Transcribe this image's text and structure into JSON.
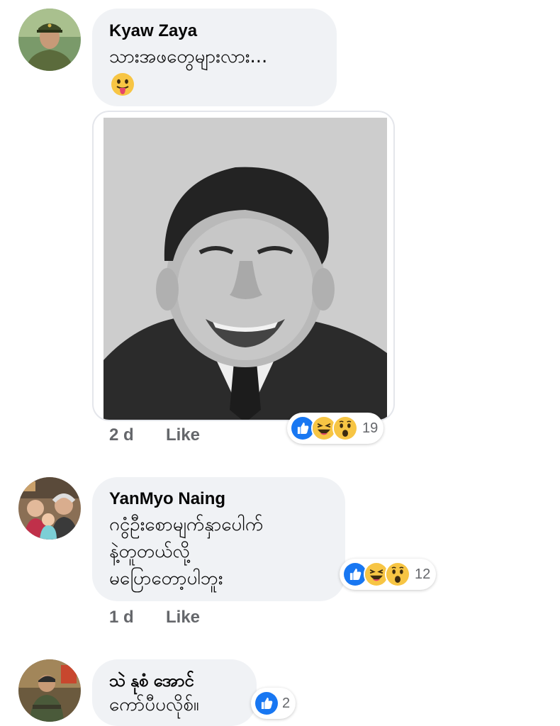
{
  "comments": [
    {
      "author": "Kyaw Zaya",
      "text_lines": [
        "သားအဖတွေများလား..."
      ],
      "emoji": "tongue-out-emoji",
      "timestamp": "2 d",
      "like_label": "Like",
      "reactions": [
        "like-reaction-icon",
        "haha-reaction-icon",
        "wow-reaction-icon"
      ],
      "reaction_count": "19"
    },
    {
      "author": "YanMyo Naing",
      "text_lines": [
        "ဂငွံဦးစောမျက်နှာပေါက်",
        "နဲ့တူတယ်လို့",
        "မပြောတော့ပါဘူး"
      ],
      "timestamp": "1 d",
      "like_label": "Like",
      "reactions": [
        "like-reaction-icon",
        "haha-reaction-icon",
        "wow-reaction-icon"
      ],
      "reaction_count": "12"
    },
    {
      "author": "သဲ နုစံ အောင်",
      "text_lines": [
        "ကော်ပီပလိုစ်။"
      ],
      "reactions": [
        "like-reaction-icon"
      ],
      "reaction_count": "2"
    }
  ],
  "colors": {
    "bubble": "#f0f2f5",
    "meta_text": "#65676b",
    "like_blue": "#1877f2",
    "emoji_yellow": "#f7c544"
  }
}
